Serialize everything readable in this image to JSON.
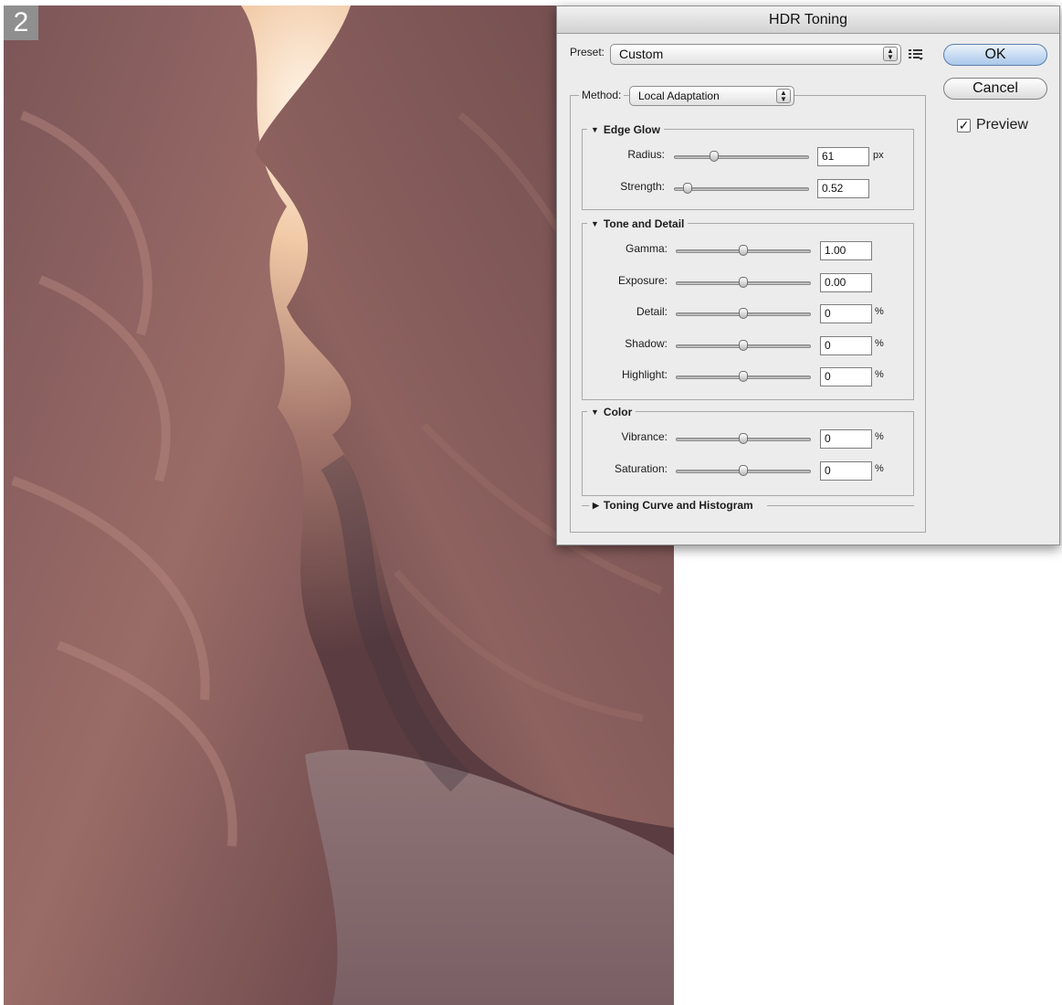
{
  "step_number": "2",
  "dialog": {
    "title": "HDR Toning",
    "preset_label": "Preset:",
    "preset_value": "Custom",
    "method_label": "Method:",
    "method_value": "Local Adaptation",
    "ok_label": "OK",
    "cancel_label": "Cancel",
    "preview_label": "Preview",
    "preview_checked": true,
    "edge_glow": {
      "title": "Edge Glow",
      "radius": {
        "label": "Radius:",
        "value": "61",
        "unit": "px",
        "slider_fraction": 0.3
      },
      "strength": {
        "label": "Strength:",
        "value": "0.52",
        "unit": "",
        "slider_fraction": 0.1
      }
    },
    "tone_and_detail": {
      "title": "Tone and Detail",
      "gamma": {
        "label": "Gamma:",
        "value": "1.00",
        "unit": "",
        "slider_fraction": 0.5
      },
      "exposure": {
        "label": "Exposure:",
        "value": "0.00",
        "unit": "",
        "slider_fraction": 0.5
      },
      "detail": {
        "label": "Detail:",
        "value": "0",
        "unit": "%",
        "slider_fraction": 0.5
      },
      "shadow": {
        "label": "Shadow:",
        "value": "0",
        "unit": "%",
        "slider_fraction": 0.5
      },
      "highlight": {
        "label": "Highlight:",
        "value": "0",
        "unit": "%",
        "slider_fraction": 0.5
      }
    },
    "color": {
      "title": "Color",
      "vibrance": {
        "label": "Vibrance:",
        "value": "0",
        "unit": "%",
        "slider_fraction": 0.5
      },
      "saturation": {
        "label": "Saturation:",
        "value": "0",
        "unit": "%",
        "slider_fraction": 0.5
      }
    },
    "toning_curve": {
      "title": "Toning Curve and Histogram",
      "expanded": false
    }
  },
  "icons": {
    "preset_menu": "list-menu-icon",
    "select_arrows": "up-down-arrows-icon",
    "expanded": "triangle-down-icon",
    "collapsed": "triangle-right-icon",
    "check": "checkmark-icon"
  }
}
